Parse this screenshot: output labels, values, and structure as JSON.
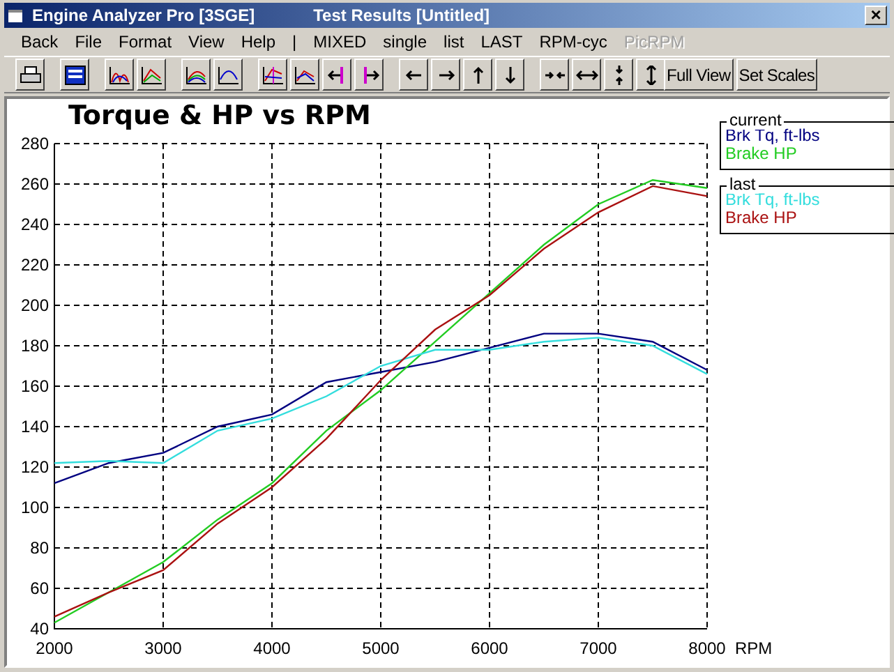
{
  "window": {
    "title": "Engine Analyzer Pro [3SGE]",
    "subtitle": "Test Results [Untitled]",
    "close": "×"
  },
  "menu": [
    {
      "label": "Back",
      "disabled": false
    },
    {
      "label": "File",
      "disabled": false
    },
    {
      "label": "Format",
      "disabled": false
    },
    {
      "label": "View",
      "disabled": false
    },
    {
      "label": "Help",
      "disabled": false
    },
    {
      "label": "|",
      "disabled": false
    },
    {
      "label": "MIXED",
      "disabled": false
    },
    {
      "label": "single",
      "disabled": false
    },
    {
      "label": "list",
      "disabled": false
    },
    {
      "label": "LAST",
      "disabled": false
    },
    {
      "label": "RPM-cyc",
      "disabled": false
    },
    {
      "label": "PicRPM",
      "disabled": true
    }
  ],
  "toolbar": {
    "text_buttons": [
      "Full View",
      "Set Scales"
    ]
  },
  "legend": [
    {
      "title": "current"
    },
    {
      "title": "last"
    }
  ],
  "chart_data": {
    "type": "line",
    "grid": true,
    "title": "Torque & HP vs RPM",
    "xlabel": "RPM",
    "x": [
      2000,
      2500,
      3000,
      3500,
      4000,
      4500,
      5000,
      5500,
      6000,
      6500,
      7000,
      7500,
      8000
    ],
    "xlim": [
      2000,
      8000
    ],
    "ylim": [
      40,
      280
    ],
    "xticks": [
      2000,
      3000,
      4000,
      5000,
      6000,
      7000,
      8000
    ],
    "yticks": [
      40,
      60,
      80,
      100,
      120,
      140,
      160,
      180,
      200,
      220,
      240,
      260,
      280
    ],
    "series": [
      {
        "name": "Brk Tq, ft-lbs",
        "color": "#000080",
        "values": [
          112,
          122,
          127,
          140,
          146,
          162,
          167,
          172,
          179,
          186,
          186,
          182,
          168
        ]
      },
      {
        "name": "Brake HP",
        "color": "#22cc22",
        "values": [
          43,
          58,
          73,
          94,
          112,
          138,
          158,
          182,
          206,
          230,
          250,
          262,
          258
        ]
      },
      {
        "name": "Brk Tq, ft-lbs",
        "color": "#33dddd",
        "values": [
          122,
          123,
          122,
          138,
          144,
          155,
          170,
          178,
          178,
          182,
          184,
          180,
          166
        ]
      },
      {
        "name": "Brake HP",
        "color": "#aa1111",
        "values": [
          46,
          58,
          69,
          92,
          110,
          134,
          163,
          188,
          205,
          228,
          246,
          259,
          254
        ]
      }
    ]
  }
}
